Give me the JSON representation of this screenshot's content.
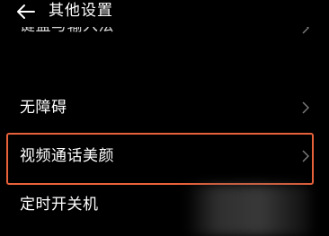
{
  "header": {
    "back_icon": "arrow-left-icon",
    "title": "其他设置"
  },
  "rows": [
    {
      "label": "键盘与输入法",
      "partially_visible": true,
      "chevron_icon": "chevron-right-icon"
    },
    {
      "label": "无障碍",
      "chevron_icon": "chevron-right-icon"
    },
    {
      "label": "视频通话美颜",
      "highlighted": true,
      "chevron_icon": "chevron-right-icon"
    },
    {
      "label": "定时开关机",
      "chevron_icon": "chevron-right-icon"
    }
  ],
  "colors": {
    "background": "#000000",
    "text": "#ffffff",
    "chevron": "#7a7a7a",
    "highlight_border": "#e8613a"
  }
}
